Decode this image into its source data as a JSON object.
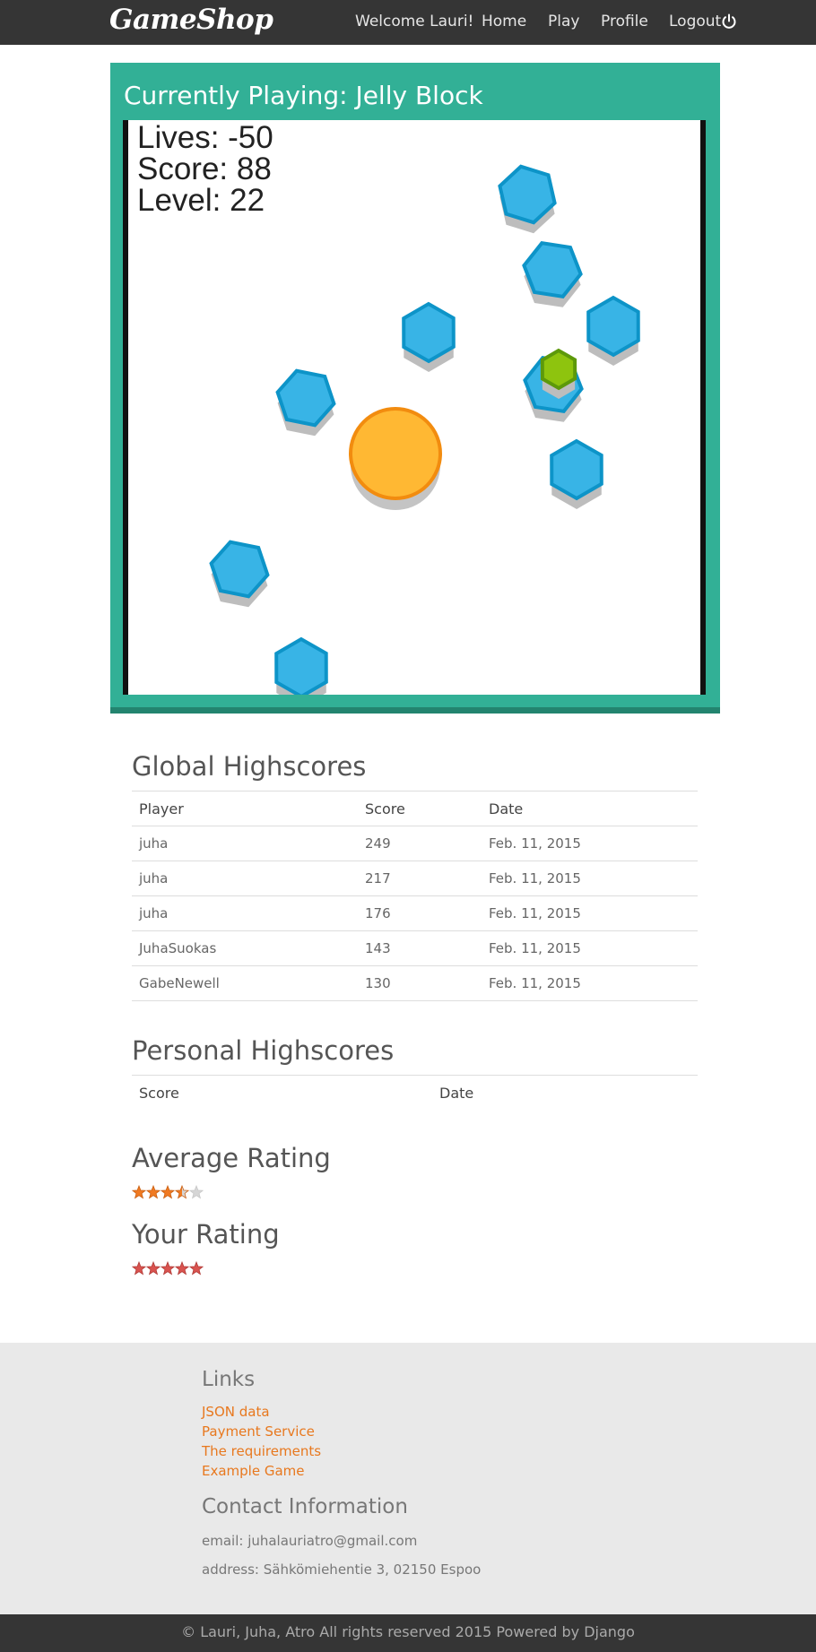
{
  "navbar": {
    "brand": "GameShop",
    "welcome": "Welcome Lauri!",
    "home": "Home",
    "play": "Play",
    "profile": "Profile",
    "logout": "Logout",
    "logout_icon": "power-icon"
  },
  "game": {
    "title": "Currently Playing: Jelly Block",
    "hud": {
      "lives": "Lives: -50",
      "score": "Score: 88",
      "level": "Level: 22"
    },
    "colors": {
      "panel": "#32b096",
      "hexagon": "#38b4e6",
      "hexagon_border": "#0d94c8",
      "player": "#ffb833",
      "player_border": "#f28c0f",
      "bonus": "#8ec40e",
      "bonus_border": "#5d990a"
    }
  },
  "global_highscores": {
    "heading": "Global Highscores",
    "columns": [
      "Player",
      "Score",
      "Date"
    ],
    "rows": [
      [
        "juha",
        "249",
        "Feb. 11, 2015"
      ],
      [
        "juha",
        "217",
        "Feb. 11, 2015"
      ],
      [
        "juha",
        "176",
        "Feb. 11, 2015"
      ],
      [
        "JuhaSuokas",
        "143",
        "Feb. 11, 2015"
      ],
      [
        "GabeNewell",
        "130",
        "Feb. 11, 2015"
      ]
    ]
  },
  "personal_highscores": {
    "heading": "Personal Highscores",
    "columns": [
      "Score",
      "Date"
    ]
  },
  "average_rating": {
    "heading": "Average Rating",
    "value": 3.5,
    "max": 5
  },
  "your_rating": {
    "heading": "Your Rating",
    "value": 5,
    "max": 5
  },
  "footer": {
    "links_heading": "Links",
    "links": [
      "JSON data",
      "Payment Service",
      "The requirements",
      "Example Game"
    ],
    "contact_heading": "Contact Information",
    "email": "email: juhalauriatro@gmail.com",
    "address": "address: Sähkömiehentie 3, 02150 Espoo",
    "copyright": "© Lauri, Juha, Atro All rights reserved 2015 Powered by Django"
  }
}
